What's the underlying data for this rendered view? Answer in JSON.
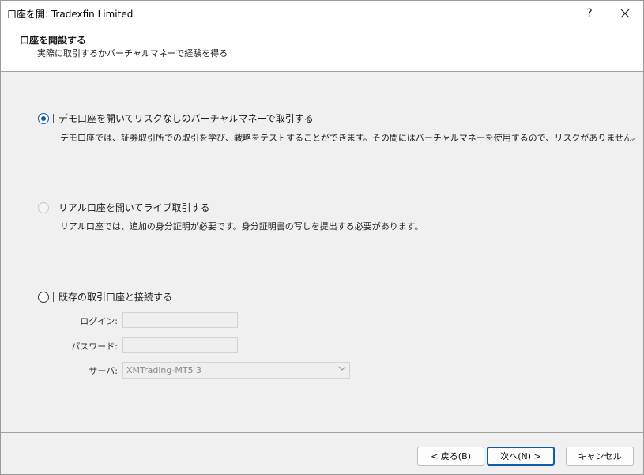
{
  "window": {
    "title": "口座を開: Tradexfin Limited",
    "help_label": "?",
    "close_label": "✕"
  },
  "header": {
    "title": "口座を開設する",
    "subtitle": "実際に取引するかバーチャルマネーで経験を得る"
  },
  "options": {
    "demo": {
      "label": "デモ口座を開いてリスクなしのバーチャルマネーで取引する",
      "description": "デモ口座では、証券取引所での取引を学び、戦略をテストすることができます。その間にはバーチャルマネーを使用するので、リスクがありません。",
      "selected": true
    },
    "real": {
      "label": "リアル口座を開いてライブ取引する",
      "description": "リアル口座では、追加の身分証明が必要です。身分証明書の写しを提出する必要があります。",
      "selected": false
    },
    "existing": {
      "label": "既存の取引口座と接続する",
      "selected": false,
      "login_label": "ログイン:",
      "login_value": "",
      "password_label": "パスワード:",
      "password_value": "",
      "server_label": "サーバ:",
      "server_value": "XMTrading-MT5 3"
    }
  },
  "buttons": {
    "back": "< 戻る(B)",
    "next": "次へ(N) >",
    "cancel": "キャンセル"
  },
  "colors": {
    "accent": "#0b5cad"
  }
}
